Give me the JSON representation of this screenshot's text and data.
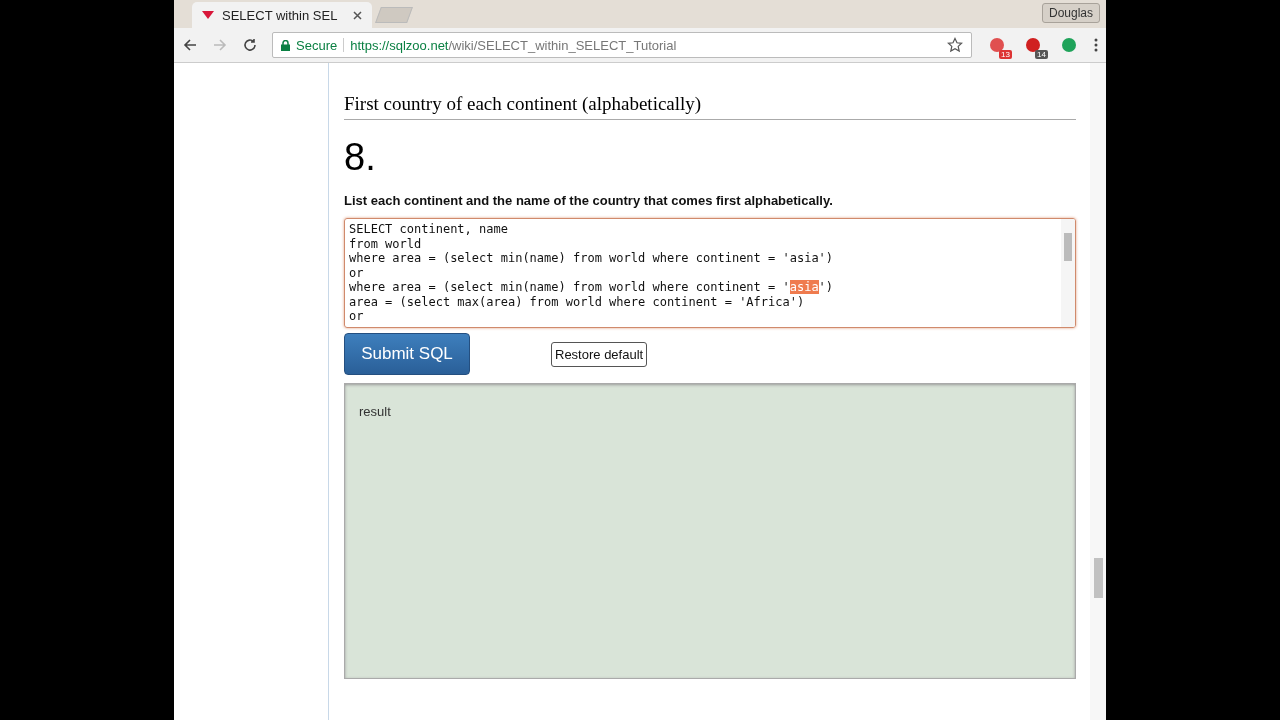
{
  "browser": {
    "tab": {
      "title": "SELECT within SEL",
      "selected": true
    },
    "profile": "Douglas",
    "secure_label": "Secure",
    "url_host": "https://sqlzoo.net",
    "url_path": "/wiki/SELECT_within_SELECT_Tutorial",
    "extensions": [
      {
        "kind": "badged",
        "badge": "13"
      },
      {
        "kind": "badged",
        "badge": "14"
      },
      {
        "kind": "plain"
      }
    ]
  },
  "page": {
    "section_title": "First country of each continent (alphabetically)",
    "number": "8.",
    "question": "List each continent and the name of the country that comes first alphabetically.",
    "code_lines": [
      {
        "segments": [
          {
            "text": "SELECT continent, name",
            "selected": false
          }
        ]
      },
      {
        "segments": [
          {
            "text": "from world",
            "selected": false
          }
        ]
      },
      {
        "segments": [
          {
            "text": "where area = (select min(name) from world where continent = 'asia')",
            "selected": false
          }
        ]
      },
      {
        "segments": [
          {
            "text": "or",
            "selected": false
          }
        ]
      },
      {
        "segments": [
          {
            "text": "where area = (select min(name) from world where continent = '",
            "selected": false
          },
          {
            "text": "asia",
            "selected": true
          },
          {
            "text": "')",
            "selected": false
          }
        ]
      },
      {
        "segments": [
          {
            "text": "area = (select max(area) from world where continent = 'Africa')",
            "selected": false
          }
        ]
      },
      {
        "segments": [
          {
            "text": "or",
            "selected": false
          }
        ]
      }
    ],
    "submit_button": "Submit SQL",
    "restore_button": "Restore default",
    "result_label": "result"
  }
}
